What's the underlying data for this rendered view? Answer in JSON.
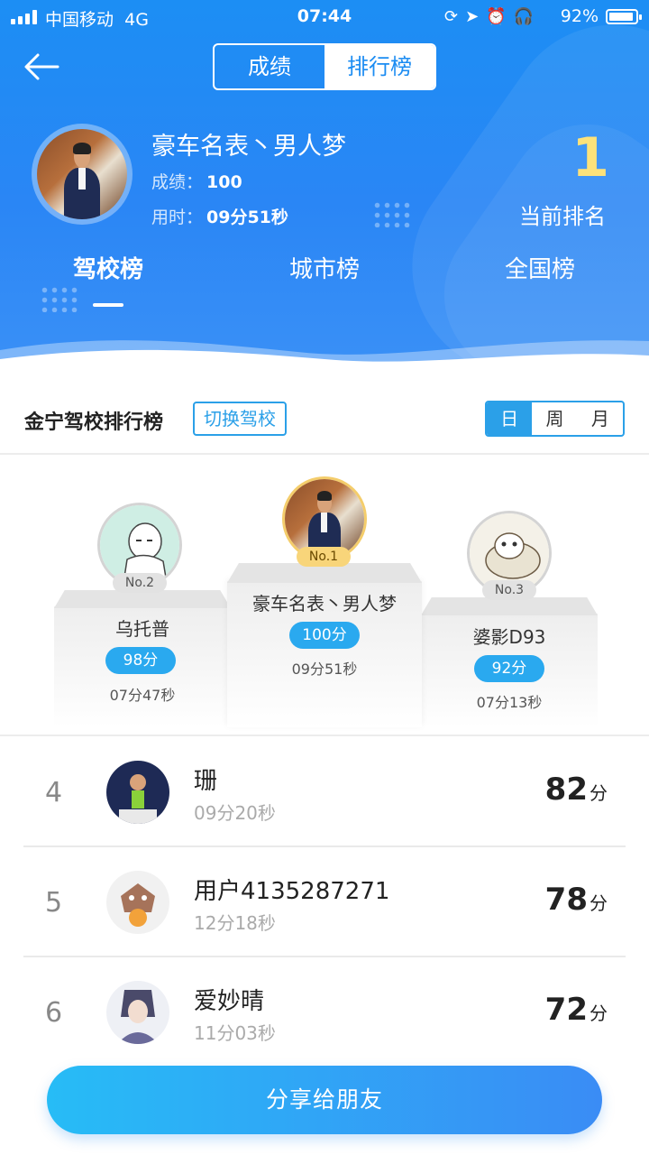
{
  "status_bar": {
    "carrier": "中国移动",
    "network": "4G",
    "time": "07:44",
    "battery": "92%",
    "icons": [
      "rotation-lock-icon",
      "location-icon",
      "alarm-icon",
      "headphones-icon"
    ]
  },
  "header": {
    "segments": [
      "成绩",
      "排行榜"
    ],
    "active_segment": "排行榜",
    "profile": {
      "name": "豪车名表丶男人梦",
      "score_label": "成绩：",
      "score_value": "100",
      "time_label": "用时：",
      "time_value": "09分51秒"
    },
    "rank_value": "1",
    "rank_label": "当前排名",
    "board_tabs": [
      "驾校榜",
      "城市榜",
      "全国榜"
    ],
    "active_board_tab": "驾校榜"
  },
  "school_bar": {
    "title": "金宁驾校排行榜",
    "switch_label": "切换驾校",
    "periods": [
      "日",
      "周",
      "月"
    ],
    "active_period": "日"
  },
  "podium": [
    {
      "badge": "No.2",
      "name": "乌托普",
      "score": "98分",
      "time": "07分47秒"
    },
    {
      "badge": "No.1",
      "name": "豪车名表丶男人梦",
      "score": "100分",
      "time": "09分51秒"
    },
    {
      "badge": "No.3",
      "name": "婆影D93",
      "score": "92分",
      "time": "07分13秒"
    }
  ],
  "rankings": [
    {
      "rank": "4",
      "name": "珊",
      "time": "09分20秒",
      "score": "82",
      "unit": "分"
    },
    {
      "rank": "5",
      "name": "用户4135287271",
      "time": "12分18秒",
      "score": "78",
      "unit": "分"
    },
    {
      "rank": "6",
      "name": "爱妙晴",
      "time": "11分03秒",
      "score": "72",
      "unit": "分"
    }
  ],
  "share_label": "分享给朋友",
  "colors": {
    "header_blue": "#1c8ef4",
    "accent": "#2aa9ef",
    "gold": "#fde27a"
  }
}
